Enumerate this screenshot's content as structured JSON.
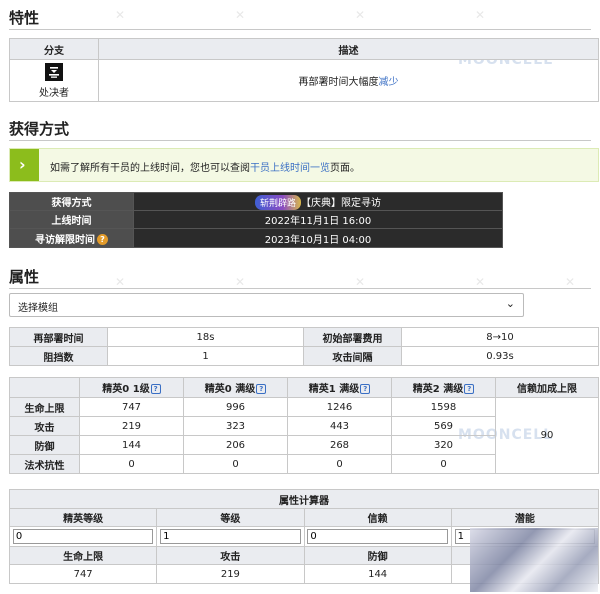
{
  "traits": {
    "title": "特性",
    "col_branch": "分支",
    "col_desc": "描述",
    "branch_name": "处决者",
    "desc_prefix": "再部署时间大幅度",
    "desc_link": "减少"
  },
  "obtain": {
    "title": "获得方式",
    "notice_prefix": "如需了解所有干员的上线时间，您也可以查阅",
    "notice_link": "干员上线时间一览",
    "notice_suffix": "页面。",
    "rows": [
      {
        "label": "获得方式",
        "tag": "斩荆辟路",
        "value": "【庆典】限定寻访"
      },
      {
        "label": "上线时间",
        "value": "2022年11月1日 16:00"
      },
      {
        "label": "寻访解限时间",
        "value": "2023年10月1日 04:00"
      }
    ]
  },
  "attrs": {
    "title": "属性",
    "module_select": "选择模组",
    "basic": {
      "redeploy_label": "再部署时间",
      "redeploy_value": "18s",
      "cost_label": "初始部署费用",
      "cost_value": "8→10",
      "block_label": "阻挡数",
      "block_value": "1",
      "interval_label": "攻击间隔",
      "interval_value": "0.93s"
    },
    "stats": {
      "headers": [
        "精英0 1级",
        "精英0 满级",
        "精英1 满级",
        "精英2 满级",
        "信赖加成上限"
      ],
      "rows": [
        {
          "label": "生命上限",
          "values": [
            "747",
            "996",
            "1246",
            "1598"
          ]
        },
        {
          "label": "攻击",
          "values": [
            "219",
            "323",
            "443",
            "569"
          ]
        },
        {
          "label": "防御",
          "values": [
            "144",
            "206",
            "268",
            "320"
          ]
        },
        {
          "label": "法术抗性",
          "values": [
            "0",
            "0",
            "0",
            "0"
          ]
        }
      ],
      "trust_value": "90"
    },
    "calc": {
      "title": "属性计算器",
      "input_labels": [
        "精英等级",
        "等级",
        "信赖",
        "潜能"
      ],
      "input_values": [
        "0",
        "1",
        "0",
        "1"
      ],
      "result_labels": [
        "生命上限",
        "攻击",
        "防御"
      ],
      "result_values": [
        "747",
        "219",
        "144"
      ]
    }
  },
  "watermark": "MOONCELL"
}
